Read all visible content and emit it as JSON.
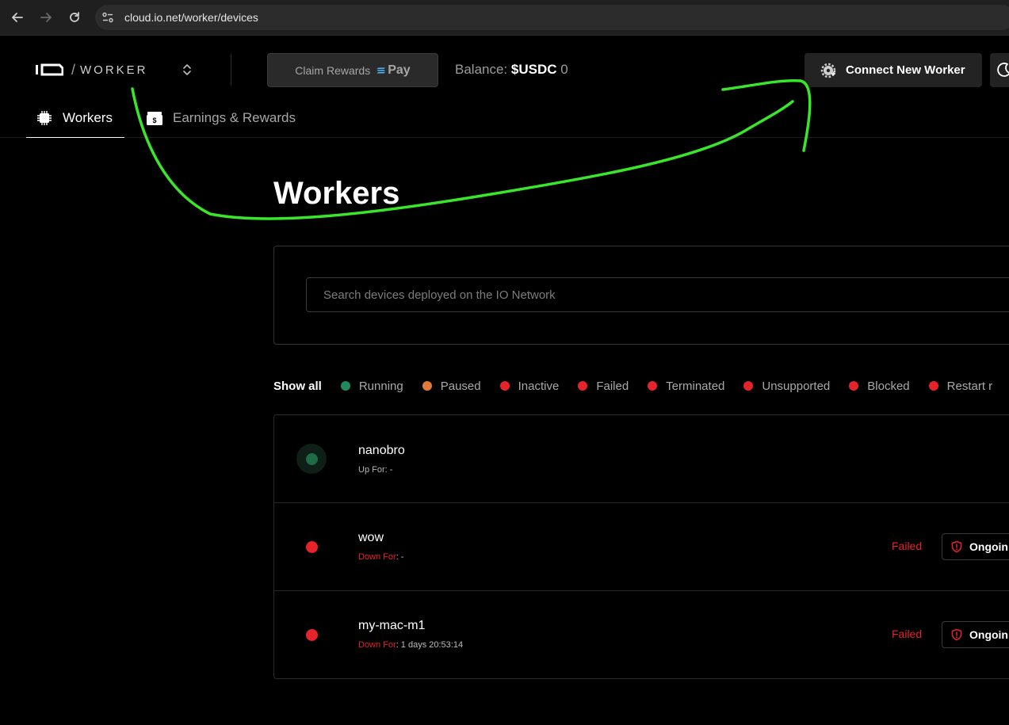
{
  "browser": {
    "url": "cloud.io.net/worker/devices",
    "back_icon": "arrow-left-icon",
    "forward_icon": "arrow-right-icon",
    "reload_icon": "reload-icon"
  },
  "header": {
    "logo_text": "io",
    "logo_slash": "/",
    "logo_product": "WORKER",
    "claim_rewards_label": "Claim Rewards",
    "pay_brand": "Pay",
    "balance_label": "Balance: ",
    "balance_currency": "$USDC",
    "balance_amount": "0",
    "connect_button_label": "Connect New Worker",
    "theme_icon": "moon-icon"
  },
  "tabs": [
    {
      "label": "Workers",
      "icon": "chip-icon",
      "active": true
    },
    {
      "label": "Earnings & Rewards",
      "icon": "wallet-icon",
      "active": false
    }
  ],
  "main": {
    "title": "Workers",
    "search_placeholder": "Search devices deployed on the IO Network",
    "search_value": "",
    "filters_show_all": "Show all",
    "filters": [
      {
        "label": "Running",
        "color": "#1f8a5b"
      },
      {
        "label": "Paused",
        "color": "#e07a3a"
      },
      {
        "label": "Inactive",
        "color": "#e5232b"
      },
      {
        "label": "Failed",
        "color": "#e5232b"
      },
      {
        "label": "Terminated",
        "color": "#e5232b"
      },
      {
        "label": "Unsupported",
        "color": "#e5232b"
      },
      {
        "label": "Blocked",
        "color": "#e5232b"
      },
      {
        "label": "Restart r",
        "color": "#e5232b"
      }
    ]
  },
  "devices": [
    {
      "name": "nanobro",
      "uptime_label": "Up For",
      "uptime_value": ": -",
      "status": "",
      "action": "",
      "dot_color": "#1f6b47"
    },
    {
      "name": "wow",
      "uptime_label": "Down For",
      "uptime_value": ": -",
      "status": "Failed",
      "action": "Ongoin",
      "dot_color": "#e5232b"
    },
    {
      "name": "my-mac-m1",
      "uptime_label": "Down For",
      "uptime_value": ": 1 days 20:53:14",
      "status": "Failed",
      "action": "Ongoin",
      "dot_color": "#e5232b"
    }
  ],
  "colors": {
    "background": "#000000",
    "accent_running": "#1f8a5b",
    "accent_failed": "#e5232b",
    "annotation_arrow": "#39e629"
  }
}
